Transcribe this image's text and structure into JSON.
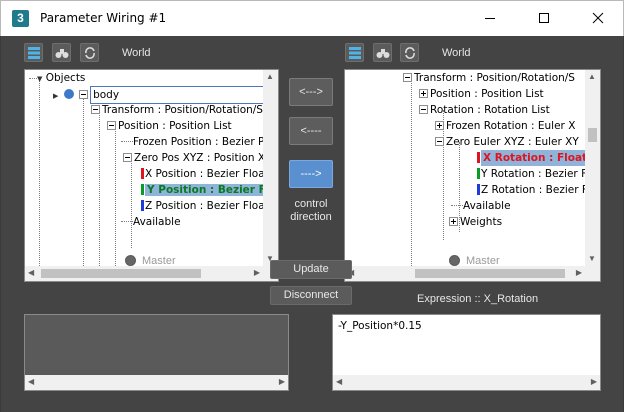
{
  "window": {
    "title": "Parameter Wiring #1",
    "app_icon_label": "3"
  },
  "left_panel": {
    "world_label": "World",
    "master_label": "Master",
    "tree": [
      {
        "label": "Objects"
      },
      {
        "label": "body"
      },
      {
        "label": "Transform : Position/Rotation/Sca"
      },
      {
        "label": "Position : Position List"
      },
      {
        "label": "Frozen Position : Bezier Pos"
      },
      {
        "label": "Zero Pos XYZ : Position XYZ"
      },
      {
        "label": "X Position : Bezier Float"
      },
      {
        "label": "Y Position : Bezier Flo"
      },
      {
        "label": "Z Position : Bezier Float"
      },
      {
        "label": "Available"
      }
    ]
  },
  "right_panel": {
    "world_label": "World",
    "master_label": "Master",
    "tree": [
      {
        "label": "Transform : Position/Rotation/S"
      },
      {
        "label": "Position : Position List"
      },
      {
        "label": "Rotation : Rotation List"
      },
      {
        "label": "Frozen Rotation : Euler X"
      },
      {
        "label": "Zero Euler XYZ : Euler XY"
      },
      {
        "label": "X Rotation : Float W"
      },
      {
        "label": "Y Rotation : Bezier Flo"
      },
      {
        "label": "Z Rotation : Bezier Flo"
      },
      {
        "label": "Available"
      },
      {
        "label": "Weights"
      }
    ]
  },
  "direction": {
    "two_way": "<--->",
    "right_to_left": "<----",
    "left_to_right": "---->",
    "label_line1": "control",
    "label_line2": "direction"
  },
  "buttons": {
    "update": "Update",
    "disconnect": "Disconnect"
  },
  "expression": {
    "label": "Expression :: X_Rotation",
    "text": "-Y_Position*0.15"
  },
  "colors": {
    "accent": "#5a8fd0",
    "selected_green": "#0a7a1e",
    "selected_red": "#e0141e"
  }
}
